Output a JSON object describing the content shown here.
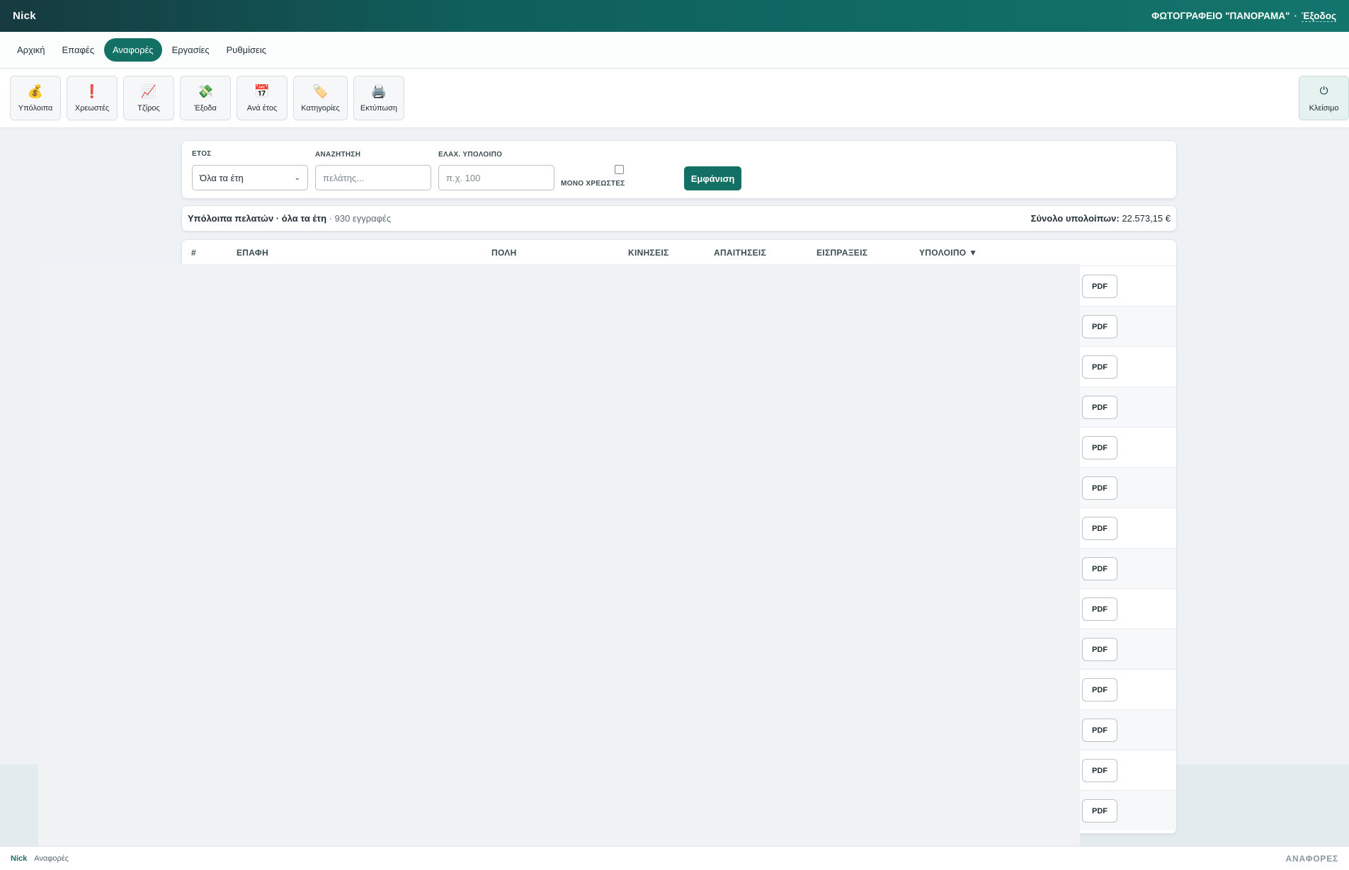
{
  "header": {
    "brand": "Nick",
    "company": "ΦΩΤΟΓΡΑΦΕΙΟ \"ΠΑΝΟΡΑΜΑ\"",
    "separator": "·",
    "logout": "Έξοδος"
  },
  "nav": {
    "tabs": [
      {
        "label": "Αρχική"
      },
      {
        "label": "Επαφές"
      },
      {
        "label": "Αναφορές"
      },
      {
        "label": "Εργασίες"
      },
      {
        "label": "Ρυθμίσεις"
      }
    ],
    "active": "Αναφορές"
  },
  "toolbar": {
    "buttons": [
      {
        "label": "Υπόλοιπα",
        "icon": "💰"
      },
      {
        "label": "Χρεωστές",
        "icon": "❗"
      },
      {
        "label": "Τζίρος",
        "icon": "📈"
      },
      {
        "label": "Έξοδα",
        "icon": "💸"
      },
      {
        "label": "Ανά έτος",
        "icon": "📅"
      },
      {
        "label": "Κατηγορίες",
        "icon": "🏷️"
      },
      {
        "label": "Εκτύπωση",
        "icon": "🖨️"
      }
    ],
    "close": {
      "label": "Κλείσιμο",
      "icon": "⏻"
    }
  },
  "filters": {
    "year_label": "ΕΤΟΣ",
    "year_value": "Όλα τα έτη",
    "search_label": "ΑΝΑΖΗΤΗΣΗ",
    "search_placeholder": "πελάτης...",
    "min_balance_label": "ΕΛΑΧ. ΥΠΟΛΟΙΠΟ",
    "min_balance_placeholder": "π.χ. 100",
    "only_debtors_label": "ΜΟΝΟ ΧΡΕΩΣΤΕΣ",
    "only_debtors_checked": false,
    "show_button": "Εμφάνιση"
  },
  "summary": {
    "title": "Υπόλοιπα πελατών · όλα τα έτη",
    "count": "· 930 εγγραφές",
    "total_label": "Σύνολο υπολοίπων:",
    "total_value": "22.573,15 €"
  },
  "table": {
    "columns": [
      "#",
      "ΕΠΑΦΗ",
      "ΠΟΛΗ",
      "ΚΙΝΗΣΕΙΣ",
      "ΑΠΑΙΤΗΣΕΙΣ",
      "ΕΙΣΠΡΑΞΕΙΣ",
      "ΥΠΟΛΟΙΠΟ ▼"
    ],
    "row_action": "PDF",
    "visible_rows": 14
  },
  "footer": {
    "brand": "Nick",
    "crumb": "Αναφορές",
    "section": "ΑΝΑΦΟΡΕΣ"
  }
}
